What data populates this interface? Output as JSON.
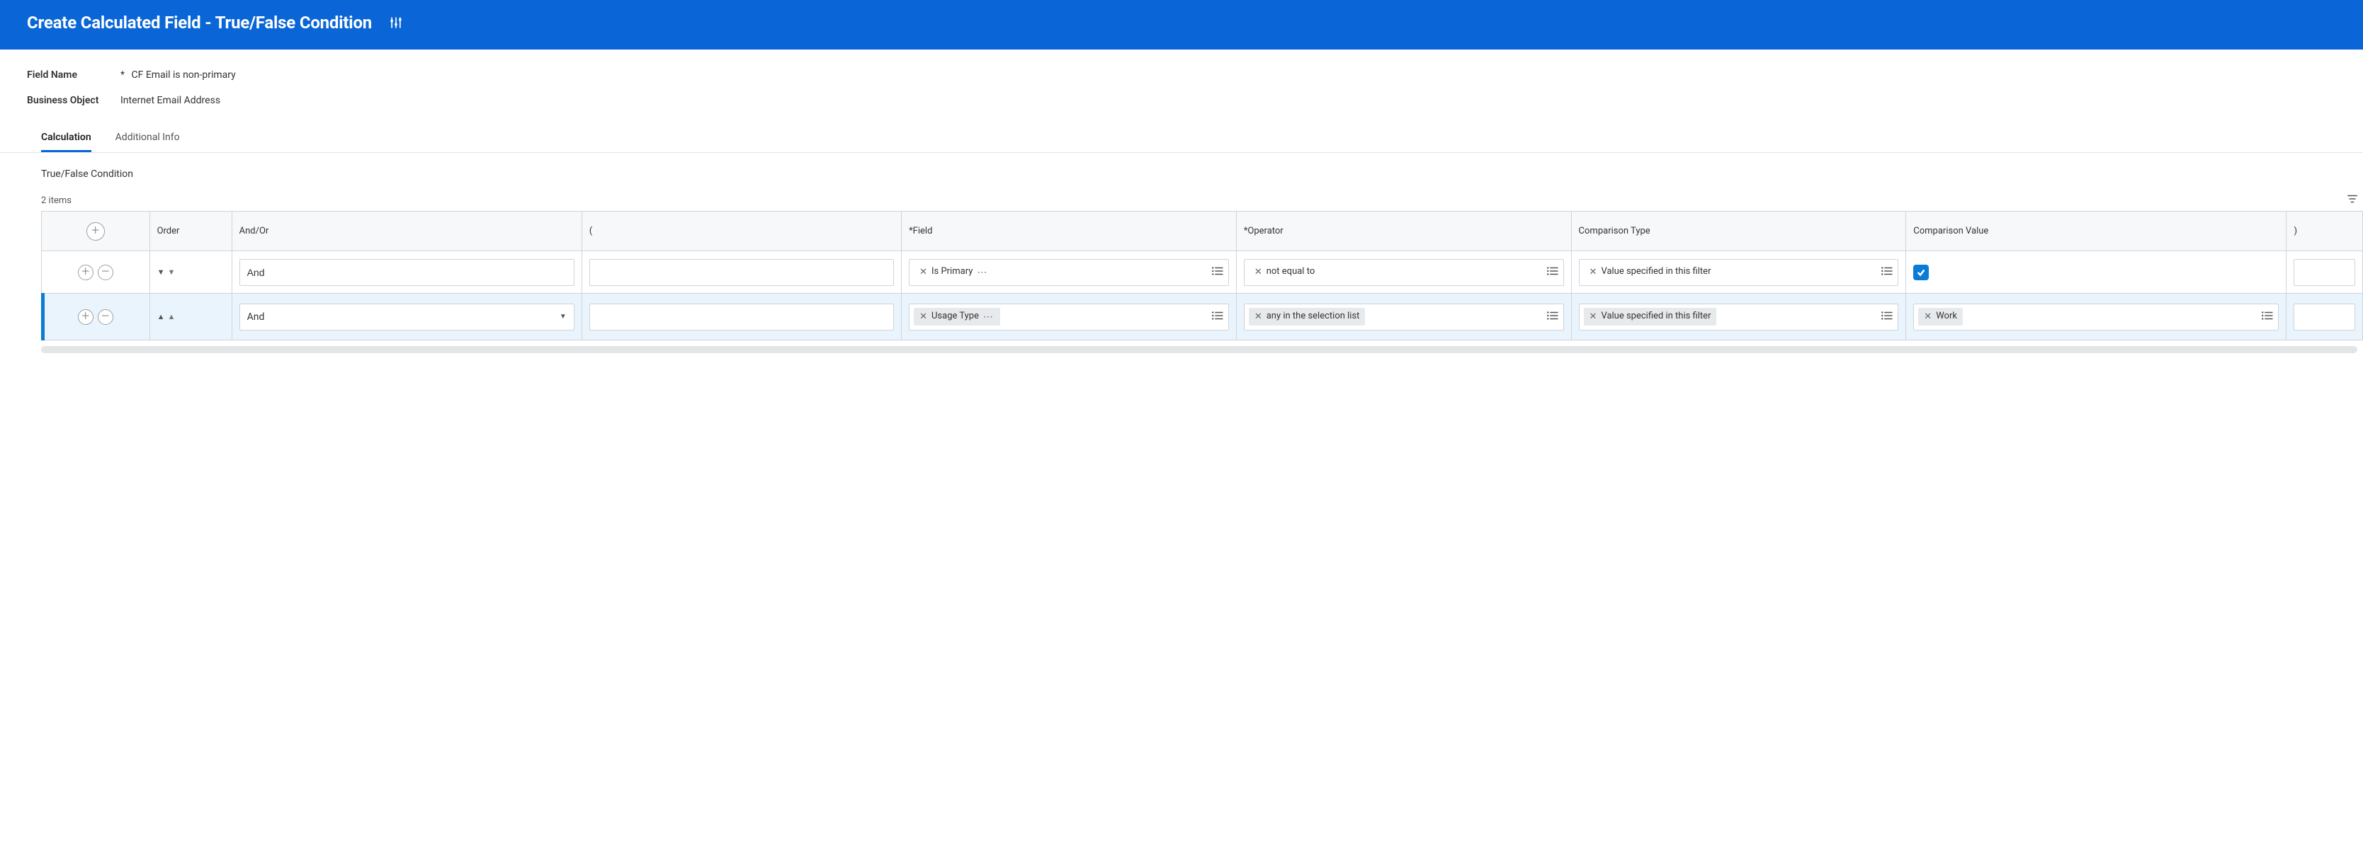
{
  "header": {
    "title": "Create Calculated Field - True/False Condition"
  },
  "form": {
    "field_name_label": "Field Name",
    "field_name_required": "*",
    "field_name_value": "CF Email is non-primary",
    "business_object_label": "Business Object",
    "business_object_value": "Internet Email Address"
  },
  "tabs": {
    "calculation": "Calculation",
    "additional": "Additional Info"
  },
  "section": {
    "title": "True/False Condition"
  },
  "items_count": "2 items",
  "columns": {
    "order": "Order",
    "andor": "And/Or",
    "lparen": "(",
    "field": "*Field",
    "operator": "*Operator",
    "ctype": "Comparison Type",
    "cvalue": "Comparison Value",
    "rparen": ")"
  },
  "rows": [
    {
      "andor": "And",
      "lparen": "",
      "field": "Is Primary",
      "operator": "not equal to",
      "ctype": "Value specified in this filter",
      "cvalue_checkbox": true,
      "rparen": ""
    },
    {
      "andor": "And",
      "lparen": "",
      "field": "Usage Type",
      "operator": "any in the selection list",
      "ctype": "Value specified in this filter",
      "cvalue_chip": "Work",
      "rparen": ""
    }
  ]
}
